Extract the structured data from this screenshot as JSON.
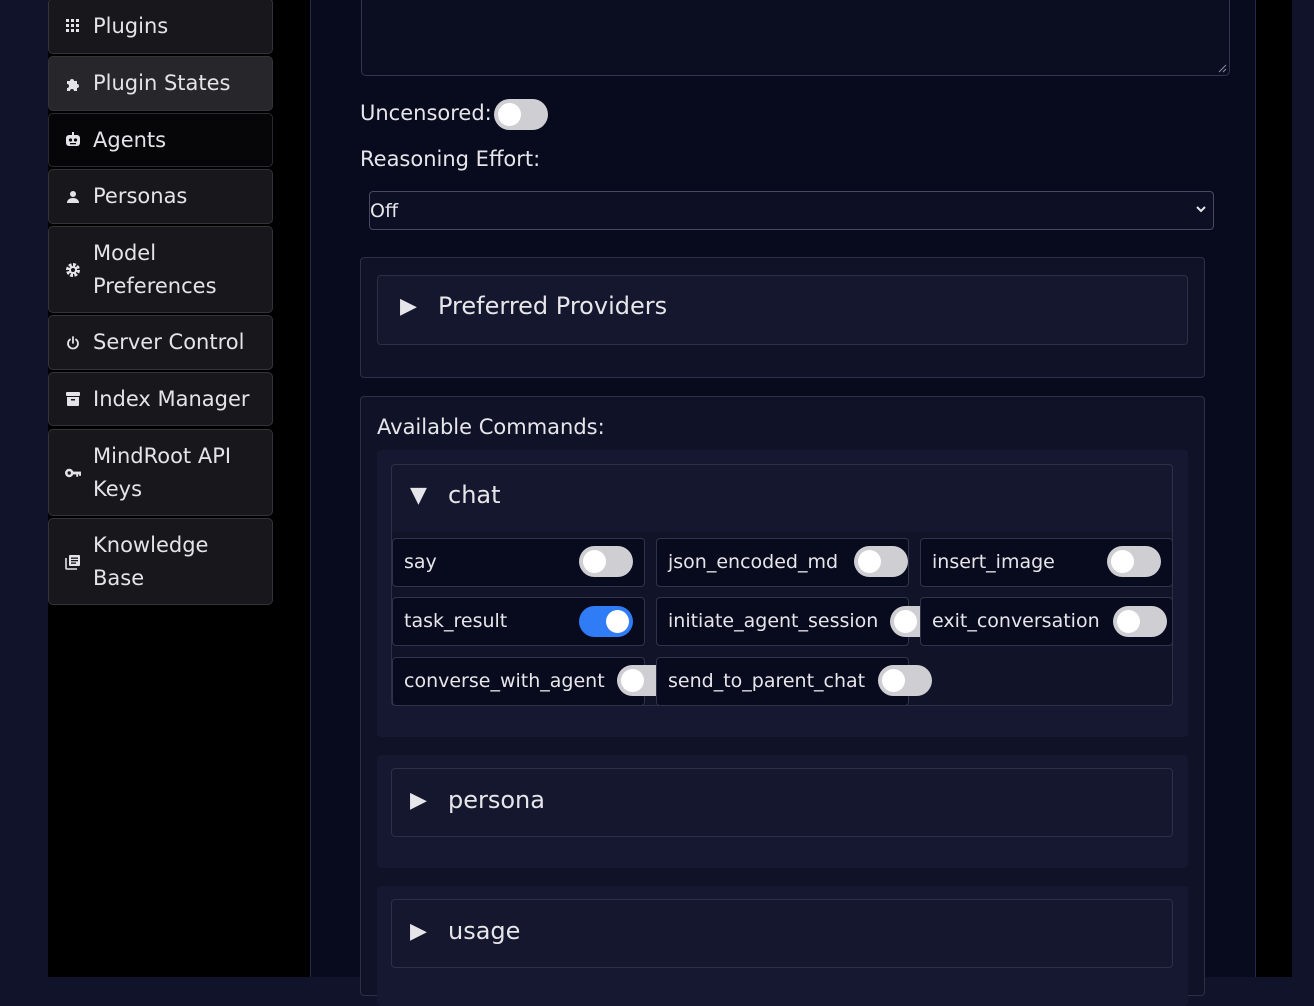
{
  "sidebar": {
    "items": [
      {
        "label": "Plugins",
        "icon": "grid-icon"
      },
      {
        "label": "Plugin States",
        "icon": "puzzle-icon"
      },
      {
        "label": "Agents",
        "icon": "robot-icon"
      },
      {
        "label": "Personas",
        "icon": "person-icon"
      },
      {
        "label": "Model Preferences",
        "icon": "gear-icon"
      },
      {
        "label": "Server Control",
        "icon": "power-icon"
      },
      {
        "label": "Index Manager",
        "icon": "archive-icon"
      },
      {
        "label": "MindRoot API Keys",
        "icon": "key-icon"
      },
      {
        "label": "Knowledge Base",
        "icon": "library-icon"
      }
    ]
  },
  "form": {
    "uncensored_label": "Uncensored:",
    "uncensored_on": false,
    "reasoning_label": "Reasoning Effort:",
    "reasoning_value": "Off",
    "preferred_providers": "Preferred Providers",
    "available_commands_label": "Available Commands:"
  },
  "commands": {
    "chat": {
      "label": "chat",
      "items": [
        {
          "name": "say",
          "enabled": false
        },
        {
          "name": "json_encoded_md",
          "enabled": false
        },
        {
          "name": "insert_image",
          "enabled": false
        },
        {
          "name": "task_result",
          "enabled": true
        },
        {
          "name": "initiate_agent_session",
          "enabled": false
        },
        {
          "name": "exit_conversation",
          "enabled": false
        },
        {
          "name": "converse_with_agent",
          "enabled": false
        },
        {
          "name": "send_to_parent_chat",
          "enabled": false
        }
      ]
    },
    "persona": {
      "label": "persona"
    },
    "usage": {
      "label": "usage"
    }
  },
  "arrows": {
    "collapsed": "▶",
    "expanded": "▼"
  },
  "colors": {
    "accent": "#2f7cf6",
    "background": "#080a1e",
    "sidebar": "#000000"
  }
}
